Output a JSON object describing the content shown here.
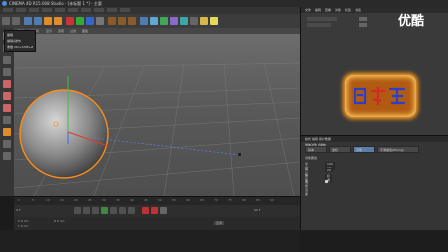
{
  "window": {
    "title": "CINEMA 4D R15.008 Studio - [未标题 1 *] - 主要",
    "watermark": "优酷"
  },
  "context_menu": {
    "items": [
      "撤销",
      "撤销(动作)",
      "重做 Ctrl+Shift+Z"
    ]
  },
  "viewport": {
    "menu": [
      "查看",
      "摄像机",
      "显示",
      "选项",
      "过滤",
      "面板"
    ]
  },
  "timeline": {
    "ruler_ticks": [
      "0",
      "5",
      "10",
      "15",
      "20",
      "25",
      "30",
      "35",
      "40",
      "45",
      "50",
      "55",
      "60",
      "65",
      "70",
      "75",
      "80",
      "85",
      "90"
    ],
    "frame_start": "0 F",
    "frame_end": "90 F"
  },
  "coordinates": {
    "x": "X 0 cm",
    "y": "Y 0 cm",
    "z": "Z 0 cm",
    "apply": "应用"
  },
  "object_manager": {
    "tabs": [
      "文件",
      "编辑",
      "查看",
      "对象",
      "标签",
      "书签"
    ]
  },
  "attribute_manager": {
    "header": "模式 编辑 用户数据",
    "object_label": "球体对象 [球体]",
    "tabs": [
      "基本",
      "坐标",
      "对象",
      "平滑着色(Phong)"
    ],
    "section": "对象属性",
    "rows": [
      {
        "label": "半径",
        "value": "100 cm"
      },
      {
        "label": "分段",
        "value": "24"
      },
      {
        "label": "类型",
        "value": "标准"
      },
      {
        "label": "理想渲染",
        "value": ""
      }
    ]
  },
  "colors": {
    "accent": "#5a7ea8",
    "selection": "#ff8c1a",
    "axis_x": "#e03a2a",
    "axis_y": "#3ac23a",
    "axis_z": "#3a6ae0"
  }
}
